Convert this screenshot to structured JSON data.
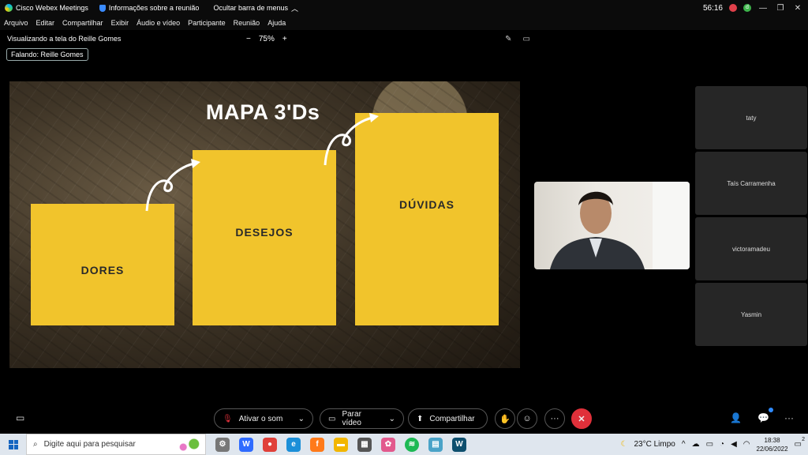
{
  "titlebar": {
    "app_name": "Cisco Webex Meetings",
    "meeting_info": "Informações sobre a reunião",
    "hide_menu": "Ocultar barra de menus",
    "timer": "56:16",
    "avatar_initial": "d"
  },
  "menu": {
    "items": [
      "Arquivo",
      "Editar",
      "Compartilhar",
      "Exibir",
      "Áudio e vídeo",
      "Participante",
      "Reunião",
      "Ajuda"
    ]
  },
  "share": {
    "viewing": "Visualizando a tela do Reille Gomes",
    "zoom": "75%",
    "speaking": "Falando: Reille Gomes"
  },
  "slide": {
    "title": "MAPA 3'Ds",
    "boxes": [
      "DORES",
      "DESEJOS",
      "DÚVIDAS"
    ]
  },
  "participants": [
    "taty",
    "Taís Carramenha",
    "victoramadeu",
    "Yasmin"
  ],
  "controls": {
    "mute": "Ativar o som",
    "video": "Parar vídeo",
    "share": "Compartilhar"
  },
  "taskbar": {
    "search_placeholder": "Digite aqui para pesquisar",
    "weather": "23°C  Limpo",
    "time": "18:38",
    "date": "22/06/2022",
    "notification_count": "2"
  },
  "colors": {
    "slide_box": "#f1c42c",
    "leave_button": "#e0303a",
    "accent": "#2f8bff"
  }
}
